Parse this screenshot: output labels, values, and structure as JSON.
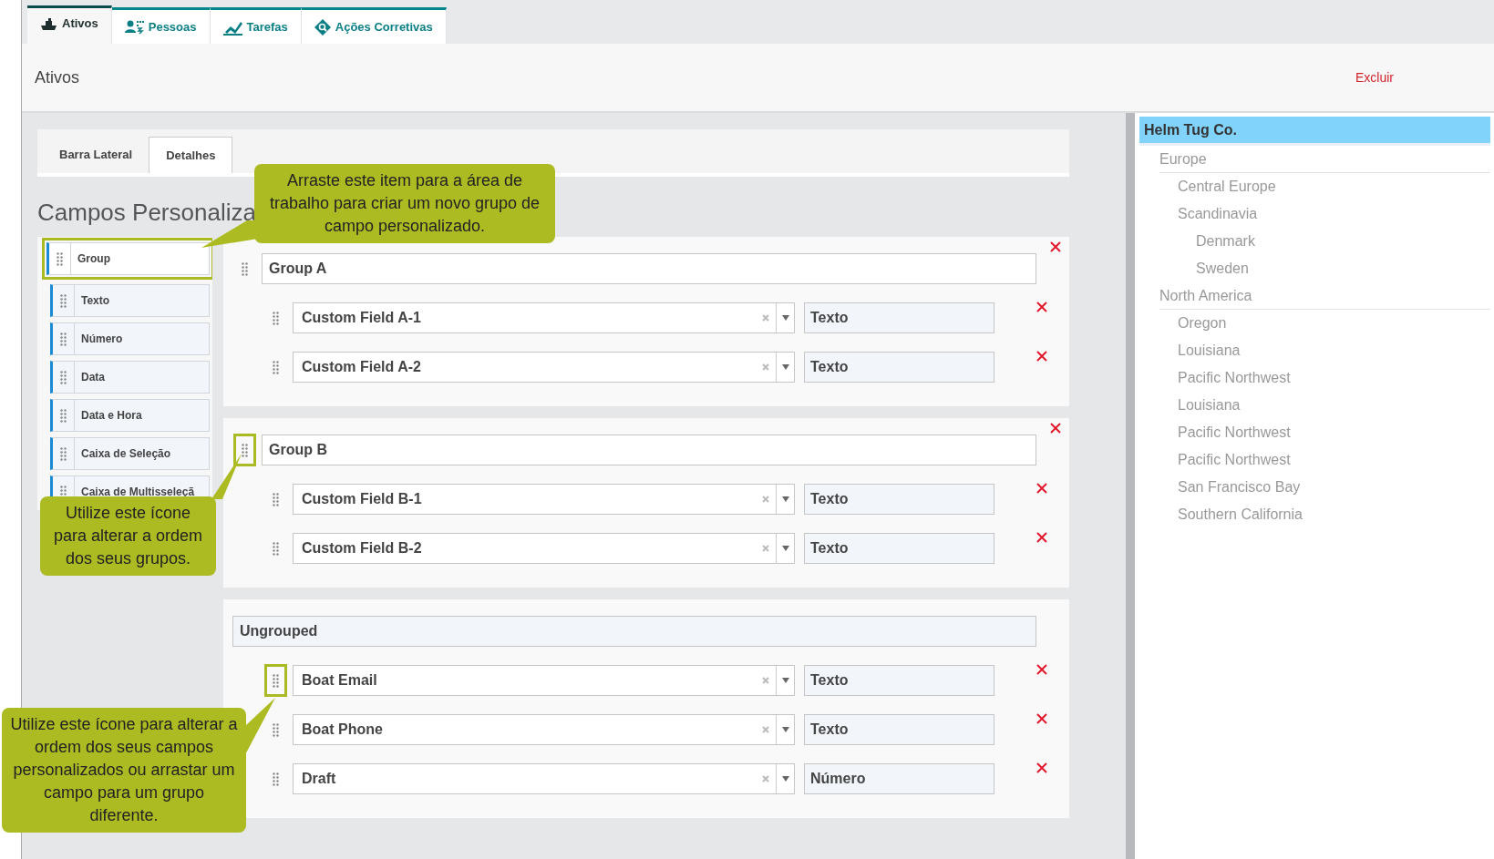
{
  "top_tabs": [
    {
      "label": "Ativos",
      "selected": true
    },
    {
      "label": "Pessoas",
      "selected": false
    },
    {
      "label": "Tarefas",
      "selected": false
    },
    {
      "label": "Ações Corretivas",
      "selected": false
    }
  ],
  "header": {
    "title": "Ativos",
    "action": "Excluir"
  },
  "sub_tabs": [
    {
      "label": "Barra Lateral",
      "selected": false
    },
    {
      "label": "Detalhes",
      "selected": true
    }
  ],
  "heading": "Campos Personaliza",
  "palette": [
    {
      "label": "Group",
      "highlighted": true
    },
    {
      "label": "Texto",
      "highlighted": false
    },
    {
      "label": "Número",
      "highlighted": false
    },
    {
      "label": "Data",
      "highlighted": false
    },
    {
      "label": "Data e Hora",
      "highlighted": false
    },
    {
      "label": "Caixa de Seleção",
      "highlighted": false
    },
    {
      "label": "Caixa de Multisseleçã",
      "highlighted": false
    }
  ],
  "groups": [
    {
      "kind": "group",
      "name": "Group A",
      "handle_highlighted": false,
      "fields": [
        {
          "name": "Custom Field A-1",
          "type": "Texto",
          "handle_highlighted": false
        },
        {
          "name": "Custom Field A-2",
          "type": "Texto",
          "handle_highlighted": false
        }
      ]
    },
    {
      "kind": "group",
      "name": "Group B",
      "handle_highlighted": true,
      "fields": [
        {
          "name": "Custom Field B-1",
          "type": "Texto",
          "handle_highlighted": false
        },
        {
          "name": "Custom Field B-2",
          "type": "Texto",
          "handle_highlighted": false
        }
      ]
    },
    {
      "kind": "ungrouped",
      "name": "Ungrouped",
      "fields": [
        {
          "name": "Boat Email",
          "type": "Texto",
          "handle_highlighted": true
        },
        {
          "name": "Boat Phone",
          "type": "Texto",
          "handle_highlighted": false
        },
        {
          "name": "Draft",
          "type": "Número",
          "handle_highlighted": false
        }
      ]
    }
  ],
  "tree": {
    "label": "Helm Tug Co.",
    "selected": true,
    "children": [
      {
        "label": "Europe",
        "children": [
          {
            "label": "Central Europe"
          },
          {
            "label": "Scandinavia",
            "children": [
              {
                "label": "Denmark"
              },
              {
                "label": "Sweden"
              }
            ]
          }
        ]
      },
      {
        "label": "North America",
        "children": [
          {
            "label": "Oregon"
          },
          {
            "label": "Louisiana"
          },
          {
            "label": "Pacific Northwest"
          },
          {
            "label": "Louisiana"
          },
          {
            "label": "Pacific Northwest"
          },
          {
            "label": "Pacific Northwest"
          },
          {
            "label": "San Francisco Bay"
          },
          {
            "label": "Southern California"
          }
        ]
      }
    ]
  },
  "callouts": [
    {
      "text": "Arraste este item para a área de trabalho para criar um novo grupo de campo personalizado."
    },
    {
      "text": "Utilize este ícone para alterar a ordem dos seus grupos."
    },
    {
      "text": "Utilize este ícone para alterar a ordem dos seus campos personalizados ou arrastar um campo para um grupo diferente."
    }
  ]
}
